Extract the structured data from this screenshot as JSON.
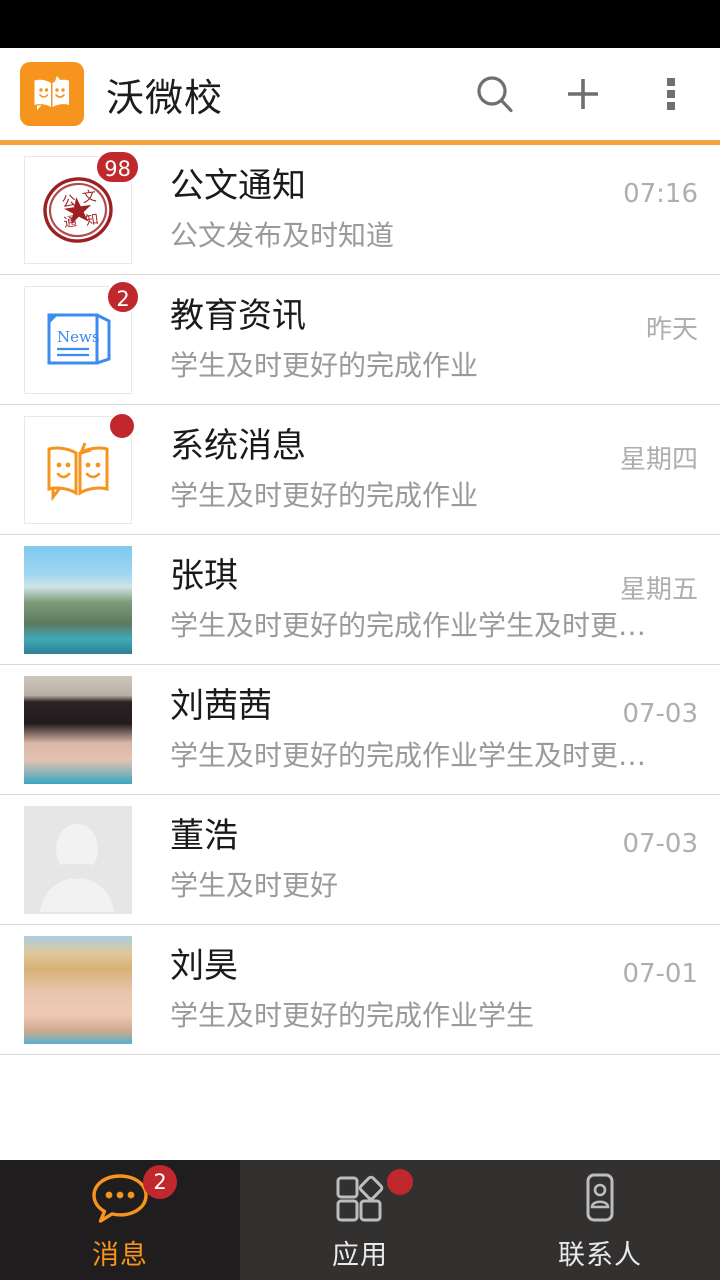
{
  "statusbar": {
    "background": "#000000"
  },
  "header": {
    "title": "沃微校",
    "logo_icon": "book-faces-logo-icon",
    "accent_color": "#f7941e",
    "rule_color": "#f5a33c",
    "actions": [
      {
        "name": "search-icon",
        "label": "搜索"
      },
      {
        "name": "add-icon",
        "label": "添加"
      },
      {
        "name": "overflow-menu-icon",
        "label": "更多"
      }
    ]
  },
  "conversations": [
    {
      "name": "公文通知",
      "preview": "公文发布及时知道",
      "time": "07:16",
      "badge": "98",
      "badge_type": "count",
      "avatar": "official-seal-icon"
    },
    {
      "name": "教育资讯",
      "preview": "学生及时更好的完成作业",
      "time": "昨天",
      "badge": "2",
      "badge_type": "count",
      "avatar": "news-paper-icon"
    },
    {
      "name": "系统消息",
      "preview": "学生及时更好的完成作业",
      "time": "星期四",
      "badge": "",
      "badge_type": "dot",
      "avatar": "book-faces-icon"
    },
    {
      "name": "张琪",
      "preview": "学生及时更好的完成作业学生及时更好的…",
      "time": "星期五",
      "badge": "",
      "badge_type": "none",
      "avatar": "landscape-photo-avatar"
    },
    {
      "name": "刘茜茜",
      "preview": "学生及时更好的完成作业学生及时更好的…",
      "time": "07-03",
      "badge": "",
      "badge_type": "none",
      "avatar": "portrait-photo-avatar"
    },
    {
      "name": "董浩",
      "preview": "学生及时更好",
      "time": "07-03",
      "badge": "",
      "badge_type": "none",
      "avatar": "default-person-avatar"
    },
    {
      "name": "刘昊",
      "preview": "学生及时更好的完成作业学生",
      "time": "07-01",
      "badge": "",
      "badge_type": "none",
      "avatar": "hat-portrait-photo-avatar"
    }
  ],
  "tabbar": {
    "background": "#333030",
    "active_background": "#1f1d1d",
    "active_color": "#f7941e",
    "items": [
      {
        "label": "消息",
        "icon": "chat-bubble-icon",
        "badge": "2",
        "badge_type": "count",
        "active": true
      },
      {
        "label": "应用",
        "icon": "apps-grid-icon",
        "badge": "",
        "badge_type": "dot",
        "active": false
      },
      {
        "label": "联系人",
        "icon": "contact-card-icon",
        "badge": "",
        "badge_type": "none",
        "active": false
      }
    ]
  }
}
